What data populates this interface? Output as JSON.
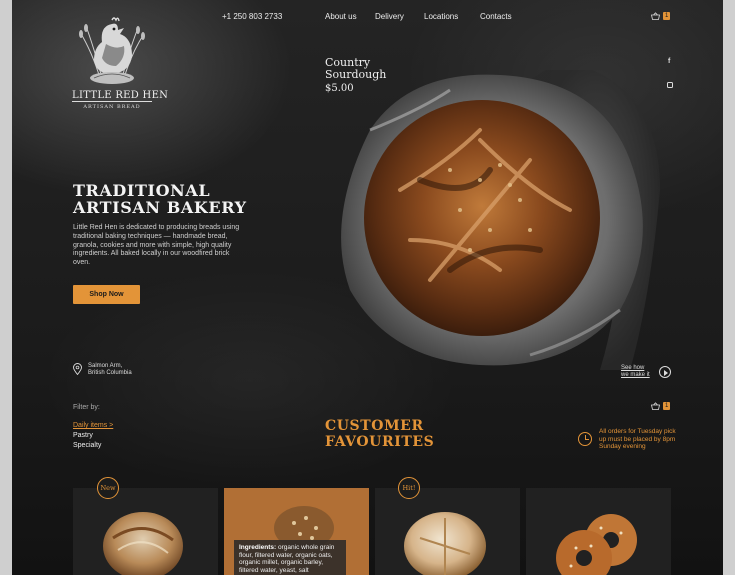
{
  "brand": {
    "name": "LITTLE RED HEN",
    "tagline": "ARTISAN BREAD"
  },
  "header": {
    "phone": "+1 250 803 2733",
    "nav": [
      "About us",
      "Delivery",
      "Locations",
      "Contacts"
    ],
    "cart_count": "1"
  },
  "social": {
    "facebook_label": "f"
  },
  "featured": {
    "name": "Country Sourdough",
    "price": "$5.00"
  },
  "hero": {
    "title": "TRADITIONAL ARTISAN BAKERY",
    "description": "Little Red Hen is dedicated to producing breads using traditional baking techniques — handmade bread, granola, cookies and more with simple, high quality ingredients. All baked locally in our woodfired brick oven.",
    "cta": "Shop Now"
  },
  "location": {
    "line1": "Salmon Arm,",
    "line2": "British Columbia"
  },
  "video": {
    "line1": "See how",
    "line2": "we make it"
  },
  "filter": {
    "label": "Filter by:",
    "items": [
      "Daily items >",
      "Pastry",
      "Specialty"
    ]
  },
  "favourites": {
    "title": "CUSTOMER FAVOURITES",
    "cart_count": "1",
    "notice": "All orders for Tuesday pick up must be placed by 8pm Sunday evening"
  },
  "products": [
    {
      "badge": "New"
    },
    {
      "ingredients_label": "Ingredients:",
      "ingredients": "organic whole grain flour, filtered water, organic oats, organic millet, organic barley, filtered water, yeast, salt"
    },
    {
      "badge": "Hit!"
    },
    {}
  ],
  "colors": {
    "accent": "#e39438",
    "background": "#1b1b1b",
    "card": "#212121",
    "card_highlight": "#b16f35"
  }
}
